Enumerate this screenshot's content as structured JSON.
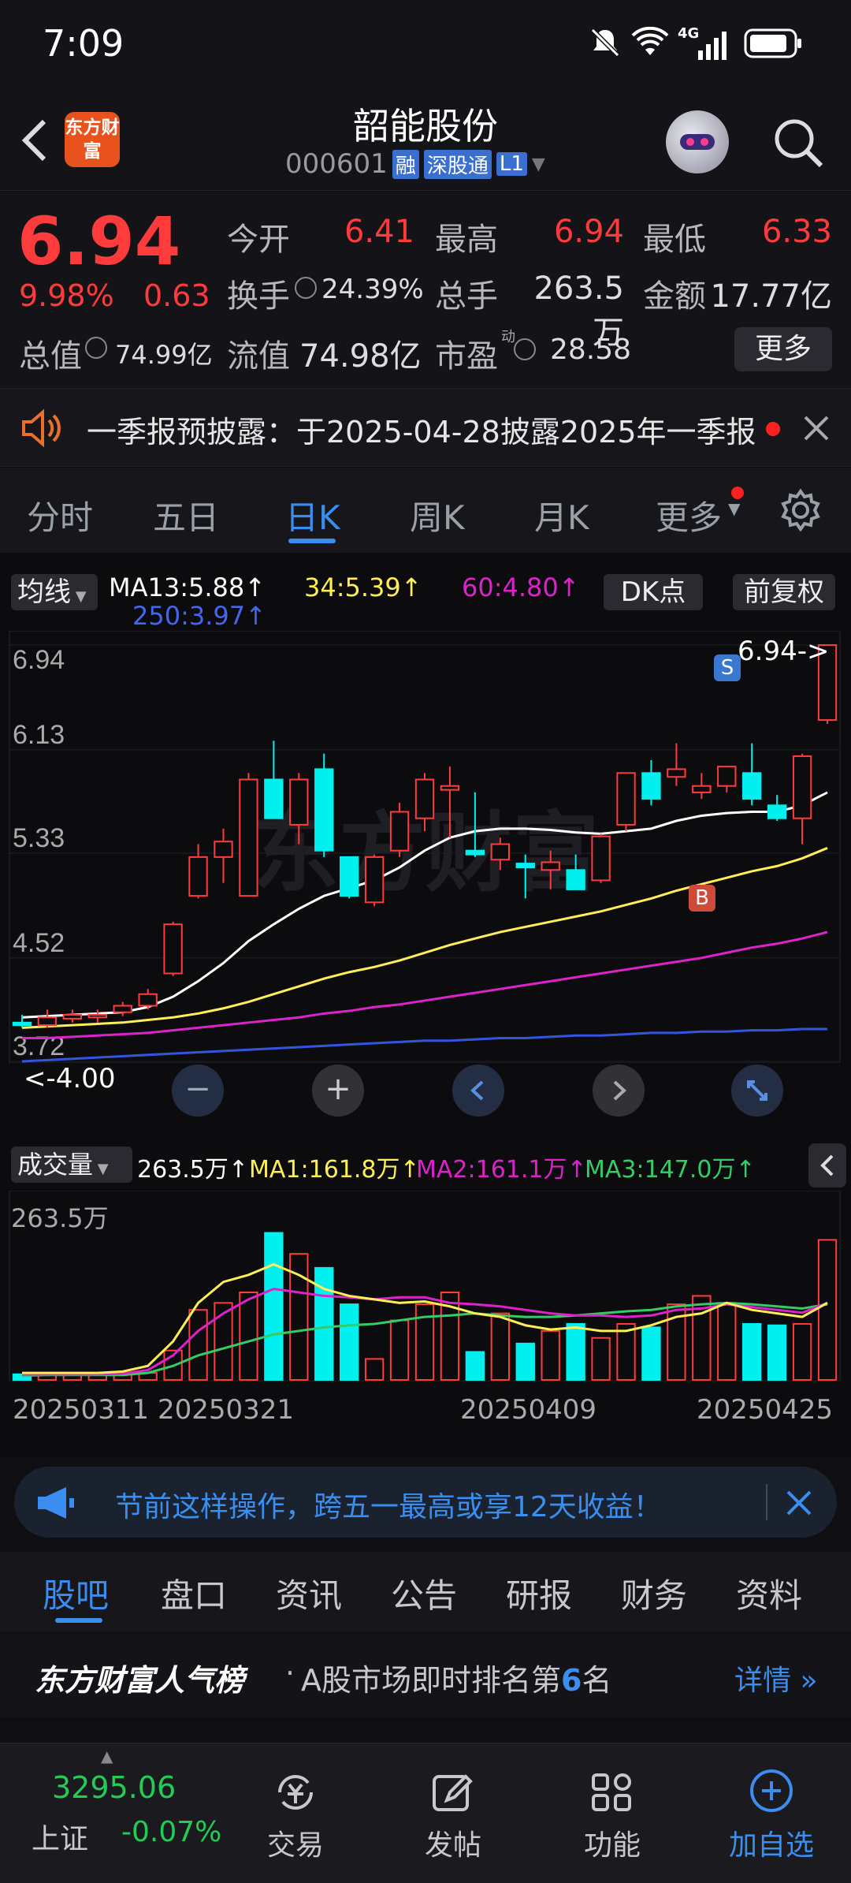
{
  "status": {
    "time": "7:09",
    "network": "4G"
  },
  "header": {
    "logo_text": "东方财富",
    "stock_name": "韶能股份",
    "stock_code": "000601",
    "tag_margin": "融",
    "tag_connect": "深股通",
    "tag_level": "L1"
  },
  "quote": {
    "price": "6.94",
    "change_pct": "9.98%",
    "change": "0.63",
    "open_label": "今开",
    "open": "6.41",
    "high_label": "最高",
    "high": "6.94",
    "low_label": "最低",
    "low": "6.33",
    "turnover_label": "换手",
    "turnover": "24.39%",
    "volume_label": "总手",
    "volume": "263.5万",
    "amount_label": "金额",
    "amount": "17.77亿",
    "mcap_label": "总值",
    "mcap": "74.99亿",
    "float_label": "流值",
    "float": "74.98亿",
    "pe_label": "市盈",
    "pe_sup": "动",
    "pe": "28.58",
    "more": "更多"
  },
  "notice": {
    "text": "一季报预披露：于2025-04-28披露2025年一季报"
  },
  "tabs": [
    {
      "label": "分时"
    },
    {
      "label": "五日"
    },
    {
      "label": "日K"
    },
    {
      "label": "周K"
    },
    {
      "label": "月K"
    },
    {
      "label": "更多"
    }
  ],
  "chart_controls": {
    "ma_button": "均线",
    "ma13": "MA13:5.88↑",
    "ma34": "34:5.39↑",
    "ma60": "60:4.80↑",
    "ma250": "250:3.97↑",
    "dk_button": "DK点",
    "adjust_button": "前复权",
    "vol_button": "成交量",
    "vol_val": "263.5万↑",
    "vol_ma1": "MA1:161.8万↑",
    "vol_ma2": "MA2:161.1万↑",
    "vol_ma3": "MA3:147.0万↑",
    "vol_scale": "263.5万",
    "last_price_marker": "6.94->",
    "low_price_marker": "<-4.00",
    "signal_sell": "S",
    "signal_buy": "B",
    "watermark": "东方财富"
  },
  "chart_data": {
    "type": "candlestick",
    "y_ticks": [
      "6.94",
      "6.13",
      "5.33",
      "4.52",
      "3.72"
    ],
    "ylim": [
      3.72,
      6.94
    ],
    "x_labels": [
      "20250311",
      "20250321",
      "20250409",
      "20250425"
    ],
    "candles": [
      {
        "o": 4.02,
        "h": 4.08,
        "l": 3.98,
        "c": 4.0
      },
      {
        "o": 4.0,
        "h": 4.12,
        "l": 3.98,
        "c": 4.06
      },
      {
        "o": 4.05,
        "h": 4.12,
        "l": 4.02,
        "c": 4.08
      },
      {
        "o": 4.06,
        "h": 4.12,
        "l": 4.02,
        "c": 4.08
      },
      {
        "o": 4.1,
        "h": 4.18,
        "l": 4.07,
        "c": 4.15
      },
      {
        "o": 4.15,
        "h": 4.28,
        "l": 4.12,
        "c": 4.24
      },
      {
        "o": 4.4,
        "h": 4.8,
        "l": 4.38,
        "c": 4.78
      },
      {
        "o": 5.0,
        "h": 5.4,
        "l": 4.98,
        "c": 5.3
      },
      {
        "o": 5.3,
        "h": 5.52,
        "l": 5.1,
        "c": 5.42
      },
      {
        "o": 5.0,
        "h": 5.95,
        "l": 5.0,
        "c": 5.9
      },
      {
        "o": 5.9,
        "h": 6.2,
        "l": 5.6,
        "c": 5.6
      },
      {
        "o": 5.55,
        "h": 5.95,
        "l": 5.4,
        "c": 5.9
      },
      {
        "o": 5.98,
        "h": 6.1,
        "l": 5.3,
        "c": 5.35
      },
      {
        "o": 5.3,
        "h": 5.3,
        "l": 4.98,
        "c": 5.0
      },
      {
        "o": 4.95,
        "h": 5.32,
        "l": 4.92,
        "c": 5.3
      },
      {
        "o": 5.35,
        "h": 5.72,
        "l": 5.3,
        "c": 5.65
      },
      {
        "o": 5.6,
        "h": 5.95,
        "l": 5.5,
        "c": 5.9
      },
      {
        "o": 5.82,
        "h": 6.0,
        "l": 5.45,
        "c": 5.85
      },
      {
        "o": 5.35,
        "h": 5.8,
        "l": 5.3,
        "c": 5.32
      },
      {
        "o": 5.28,
        "h": 5.45,
        "l": 5.2,
        "c": 5.4
      },
      {
        "o": 5.25,
        "h": 5.32,
        "l": 4.98,
        "c": 5.22
      },
      {
        "o": 5.2,
        "h": 5.35,
        "l": 5.05,
        "c": 5.26
      },
      {
        "o": 5.2,
        "h": 5.32,
        "l": 5.05,
        "c": 5.05
      },
      {
        "o": 5.12,
        "h": 5.48,
        "l": 5.1,
        "c": 5.46
      },
      {
        "o": 5.55,
        "h": 5.95,
        "l": 5.5,
        "c": 5.95
      },
      {
        "o": 5.95,
        "h": 6.05,
        "l": 5.7,
        "c": 5.75
      },
      {
        "o": 5.92,
        "h": 6.18,
        "l": 5.85,
        "c": 5.98
      },
      {
        "o": 5.8,
        "h": 5.95,
        "l": 5.75,
        "c": 5.85
      },
      {
        "o": 5.85,
        "h": 6.0,
        "l": 5.8,
        "c": 6.0
      },
      {
        "o": 5.95,
        "h": 6.18,
        "l": 5.7,
        "c": 5.75
      },
      {
        "o": 5.7,
        "h": 5.78,
        "l": 5.58,
        "c": 5.6
      },
      {
        "o": 5.6,
        "h": 6.1,
        "l": 5.4,
        "c": 6.08
      },
      {
        "o": 6.36,
        "h": 6.94,
        "l": 6.33,
        "c": 6.94
      }
    ],
    "ma13": [
      4.06,
      4.07,
      4.08,
      4.09,
      4.1,
      4.14,
      4.22,
      4.34,
      4.48,
      4.65,
      4.78,
      4.9,
      5.0,
      5.06,
      5.12,
      5.22,
      5.35,
      5.45,
      5.5,
      5.52,
      5.52,
      5.51,
      5.49,
      5.48,
      5.5,
      5.52,
      5.58,
      5.62,
      5.64,
      5.65,
      5.65,
      5.7,
      5.8
    ],
    "ma34": [
      3.98,
      3.99,
      4.0,
      4.01,
      4.02,
      4.04,
      4.06,
      4.09,
      4.13,
      4.18,
      4.24,
      4.3,
      4.36,
      4.41,
      4.45,
      4.5,
      4.56,
      4.62,
      4.67,
      4.72,
      4.76,
      4.8,
      4.84,
      4.88,
      4.93,
      4.98,
      5.04,
      5.09,
      5.14,
      5.19,
      5.23,
      5.29,
      5.37
    ],
    "ma60": [
      3.9,
      3.9,
      3.91,
      3.92,
      3.93,
      3.94,
      3.96,
      3.98,
      4.0,
      4.02,
      4.04,
      4.06,
      4.09,
      4.11,
      4.14,
      4.16,
      4.19,
      4.22,
      4.25,
      4.28,
      4.31,
      4.34,
      4.37,
      4.4,
      4.43,
      4.46,
      4.49,
      4.52,
      4.56,
      4.6,
      4.63,
      4.67,
      4.72
    ],
    "ma250": [
      3.72,
      3.73,
      3.74,
      3.75,
      3.76,
      3.77,
      3.78,
      3.79,
      3.8,
      3.81,
      3.82,
      3.83,
      3.84,
      3.85,
      3.86,
      3.87,
      3.88,
      3.88,
      3.89,
      3.9,
      3.9,
      3.91,
      3.92,
      3.92,
      3.93,
      3.94,
      3.94,
      3.95,
      3.95,
      3.96,
      3.96,
      3.97,
      3.97
    ],
    "volume": [
      8,
      8,
      7,
      8,
      8,
      10,
      42,
      100,
      110,
      125,
      210,
      180,
      160,
      108,
      30,
      85,
      108,
      125,
      40,
      95,
      52,
      70,
      80,
      60,
      80,
      75,
      108,
      120,
      110,
      80,
      78,
      80,
      200
    ],
    "volume_ylim": [
      0,
      263.5
    ],
    "vol_ma1": [
      10,
      10,
      10,
      10,
      12,
      20,
      55,
      110,
      140,
      150,
      165,
      150,
      130,
      120,
      115,
      110,
      112,
      105,
      95,
      90,
      78,
      72,
      75,
      70,
      70,
      78,
      90,
      95,
      110,
      100,
      95,
      90,
      110
    ],
    "vol_ma2": [
      8,
      8,
      8,
      8,
      9,
      14,
      35,
      70,
      95,
      115,
      130,
      125,
      120,
      118,
      115,
      118,
      118,
      110,
      108,
      105,
      100,
      95,
      92,
      92,
      90,
      92,
      100,
      102,
      108,
      104,
      100,
      96,
      110
    ],
    "vol_ma3": [
      6,
      7,
      7,
      7,
      7,
      10,
      20,
      35,
      45,
      55,
      65,
      70,
      75,
      78,
      80,
      85,
      90,
      92,
      95,
      92,
      90,
      90,
      92,
      95,
      98,
      100,
      105,
      108,
      110,
      108,
      105,
      102,
      108
    ]
  },
  "promo": {
    "text": "节前这样操作，跨五一最高或享12天收益！"
  },
  "bottom_tabs": [
    {
      "label": "股吧"
    },
    {
      "label": "盘口"
    },
    {
      "label": "资讯"
    },
    {
      "label": "公告"
    },
    {
      "label": "研报"
    },
    {
      "label": "财务"
    },
    {
      "label": "资料"
    }
  ],
  "rank": {
    "title": "东方财富人气榜",
    "prefix": "A股市场即时排名第",
    "rank": "6",
    "suffix": "名",
    "details": "详情"
  },
  "dock": {
    "index_value": "3295.06",
    "index_name": "上证",
    "index_change": "-0.07%",
    "items": [
      {
        "label": "交易"
      },
      {
        "label": "发帖"
      },
      {
        "label": "功能"
      },
      {
        "label": "加自选"
      }
    ]
  },
  "colors": {
    "up": "#ff3b3b",
    "down": "#00f0f0",
    "accent": "#3a8ef0",
    "ma13": "#ffffff",
    "ma34": "#ffee55",
    "ma60": "#dd22cc",
    "ma250": "#3355dd"
  }
}
